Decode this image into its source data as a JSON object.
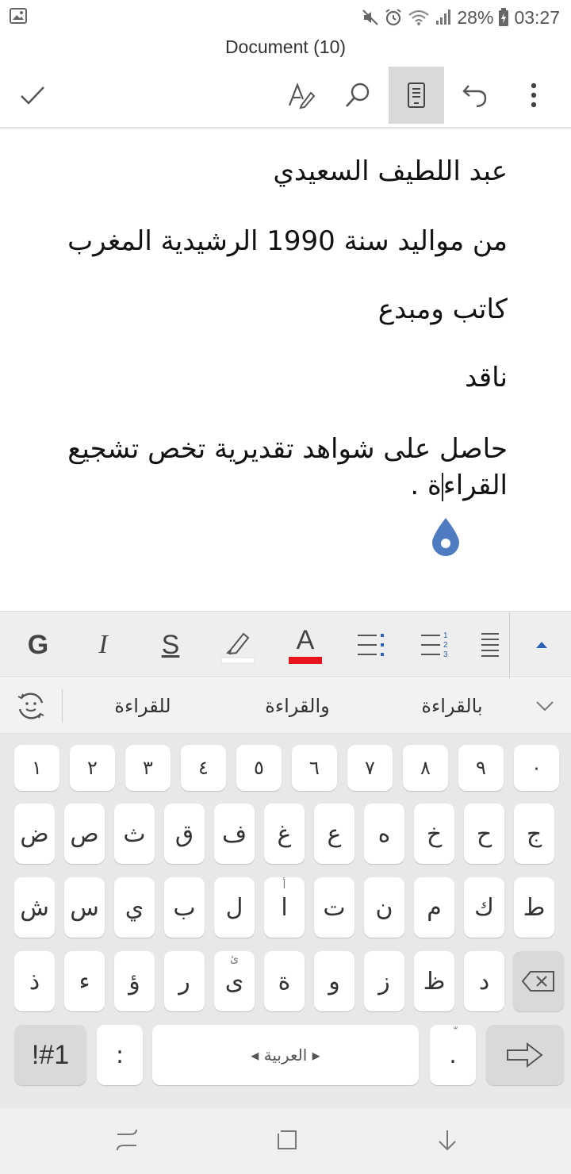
{
  "status": {
    "battery": "28%",
    "time": "03:27"
  },
  "document": {
    "title": "Document (10)",
    "paragraphs": [
      "عبد اللطيف السعيدي",
      "من مواليد سنة 1990 الرشيدية المغرب",
      "كاتب ومبدع",
      "ناقد"
    ],
    "last_paragraph_line1": "حاصل على شواهد تقديرية تخص تشجيع",
    "last_paragraph_line2_before_caret": "القراء",
    "last_paragraph_line2_after_caret": "ة ."
  },
  "formatting": {
    "bold_label": "G",
    "italic_label": "I",
    "strike_label": "S",
    "font_color_label": "A",
    "highlight_color": "#ffffff",
    "font_color": "#e8141c"
  },
  "suggestions": [
    "للقراءة",
    "والقراءة",
    "بالقراءة"
  ],
  "keyboard": {
    "row_digits": [
      "١",
      "٢",
      "٣",
      "٤",
      "٥",
      "٦",
      "٧",
      "٨",
      "٩",
      "٠"
    ],
    "row1": [
      "ض",
      "ص",
      "ث",
      "ق",
      "ف",
      "غ",
      "ع",
      "ه",
      "خ",
      "ح",
      "ج"
    ],
    "row2": [
      "ش",
      "س",
      "ي",
      "ب",
      "ل",
      "ا",
      "ت",
      "ن",
      "م",
      "ك",
      "ط"
    ],
    "row2_sub": {
      "5": "أ"
    },
    "row3": [
      "ذ",
      "ء",
      "ؤ",
      "ر",
      "ى",
      "ة",
      "و",
      "ز",
      "ظ",
      "د"
    ],
    "row3_sub": {
      "4": "ئ"
    },
    "symbols_label": "!#1",
    "colon_label": ":",
    "space_label": "◂ العربية ▸",
    "period_label": ".",
    "period_sub": "ّ"
  },
  "accent": "#2c63b8"
}
